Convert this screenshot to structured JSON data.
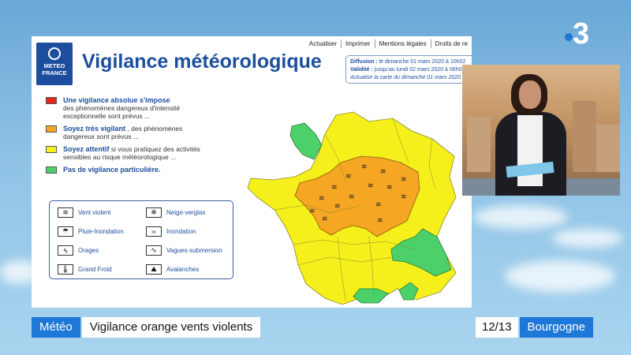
{
  "channel": {
    "logo_text": "3"
  },
  "panel": {
    "nav": [
      "Actualiser",
      "Imprimer",
      "Mentions légales",
      "Droits de re"
    ],
    "logo": {
      "line1": "METEO",
      "line2": "FRANCE"
    },
    "title": "Vigilance météorologique",
    "dates": {
      "diffusion_label": "Diffusion :",
      "diffusion_value": "le dimanche 01 mars 2020 à 10h02",
      "validite_label": "Validité :",
      "validite_value": "jusqu'au lundi 02 mars 2020 à 06h00",
      "update": "Actualise la carte du dimanche 01 mars 2020 à 0"
    },
    "legend": [
      {
        "color": "#e8231c",
        "head": "Une vigilance absolue s'impose",
        "body": "des phénomènes dangereux d'intensité exceptionnelle sont prévus ..."
      },
      {
        "color": "#f5a623",
        "head": "Soyez très vigilant",
        "body": ", des phénomènes dangereux sont prévus ..."
      },
      {
        "color": "#f5f01b",
        "head": "Soyez attentif",
        "body": "si vous pratiquez des activités sensibles au risque météorologique ..."
      },
      {
        "color": "#4cd06a",
        "head": "Pas de vigilance particulière.",
        "body": ""
      }
    ],
    "hazards": [
      {
        "label": "Vent violent",
        "icon": "wind-icon",
        "glyph": "≋"
      },
      {
        "label": "Neige-verglas",
        "icon": "snow-icon",
        "glyph": "❄"
      },
      {
        "label": "Pluie-Inondation",
        "icon": "rain-flood-icon",
        "glyph": "☂"
      },
      {
        "label": "Inondation",
        "icon": "flood-icon",
        "glyph": "≈"
      },
      {
        "label": "Orages",
        "icon": "storm-icon",
        "glyph": "ϟ"
      },
      {
        "label": "Vagues-submersion",
        "icon": "wave-icon",
        "glyph": "∿"
      },
      {
        "label": "Grand Froid",
        "icon": "thermometer-icon",
        "glyph": "🌡"
      },
      {
        "label": "Avalanches",
        "icon": "avalanche-icon",
        "glyph": "⛰"
      }
    ]
  },
  "lower_third": {
    "tag": "Météo",
    "headline": "Vigilance orange vents violents",
    "edition": "12/13",
    "region": "Bourgogne"
  },
  "colors": {
    "yellow": "#f5f01b",
    "orange": "#f5a623",
    "green": "#4cd06a",
    "red": "#e8231c",
    "blue": "#1e78d7"
  }
}
